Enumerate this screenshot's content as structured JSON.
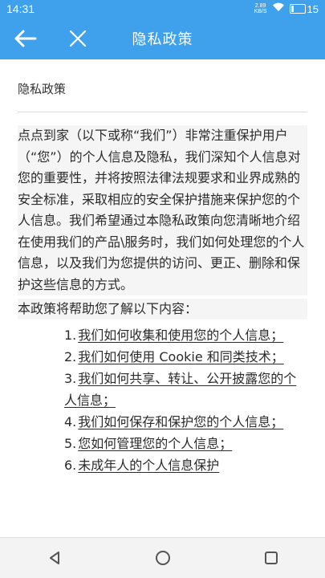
{
  "status_bar": {
    "time": "14:31",
    "net_speed_value": "2.89",
    "net_speed_unit": "KB/S",
    "battery": "15",
    "icons": [
      "wifi-icon",
      "battery-icon"
    ]
  },
  "app_bar": {
    "title": "隐私政策",
    "back_icon": "arrow-left-icon",
    "close_icon": "close-icon",
    "color": "#3fa1ec"
  },
  "document": {
    "heading": "隐私政策",
    "paragraph": "点点到家（以下或称“我们”）非常注重保护用户（“您”）的个人信息及隐私，我们深知个人信息对您的重要性，并将按照法律法规要求和业界成熟的安全标准，采取相应的安全保护措施来保护您的个人信息。我们希望通过本隐私政策向您清晰地介绍在使用我们的产品\\服务时，我们如何处理您的个人信息，以及我们为您提供的访问、更正、删除和保护这些信息的方式。",
    "intro": "本政策将帮助您了解以下内容：",
    "toc": [
      {
        "num": "1.",
        "text": "我们如何收集和使用您的个人信息；"
      },
      {
        "num": "2.",
        "text": "我们如何使用 Cookie 和同类技术；"
      },
      {
        "num": "3.",
        "text": "我们如何共享、转让、公开披露您的个人信息；"
      },
      {
        "num": "4.",
        "text": "我们如何保存和保护您的个人信息；"
      },
      {
        "num": "5.",
        "text": "您如何管理您的个人信息；"
      },
      {
        "num": "6.",
        "text": "未成年人的个人信息保护"
      }
    ]
  },
  "nav_bar": {
    "back_icon": "triangle-back-icon",
    "home_icon": "circle-home-icon",
    "recents_icon": "square-recents-icon"
  }
}
